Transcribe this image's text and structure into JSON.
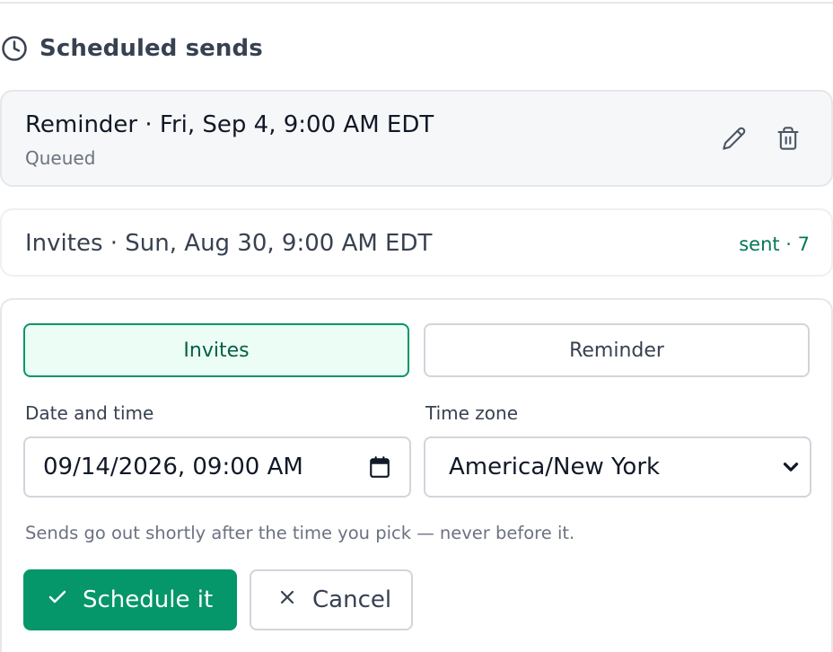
{
  "section": {
    "title": "Scheduled sends",
    "icon": "clock-icon"
  },
  "queued_item": {
    "title": "Reminder · Fri, Sep 4, 9:00 AM EDT",
    "status": "Queued",
    "edit_icon": "pencil-icon",
    "delete_icon": "trash-icon"
  },
  "sent_item": {
    "title": "Invites · Sun, Aug 30, 9:00 AM EDT",
    "count": "sent · 7"
  },
  "form": {
    "type_options": [
      "Invites",
      "Reminder"
    ],
    "selected_type": "Invites",
    "date_label": "Date and time",
    "date_value": "09/14/2026, 09:00 AM",
    "date_icon": "calendar-icon",
    "tz_label": "Time zone",
    "tz_value": "America/New York",
    "tz_icon": "chevron-down-icon",
    "hint": "Sends go out shortly after the time you pick — never before it.",
    "submit_label": "Schedule it",
    "submit_icon": "check-icon",
    "cancel_label": "Cancel",
    "cancel_icon": "x-icon"
  },
  "colors": {
    "accent": "#059669",
    "accent_light": "#ecfdf5",
    "sent_text": "#047857"
  }
}
